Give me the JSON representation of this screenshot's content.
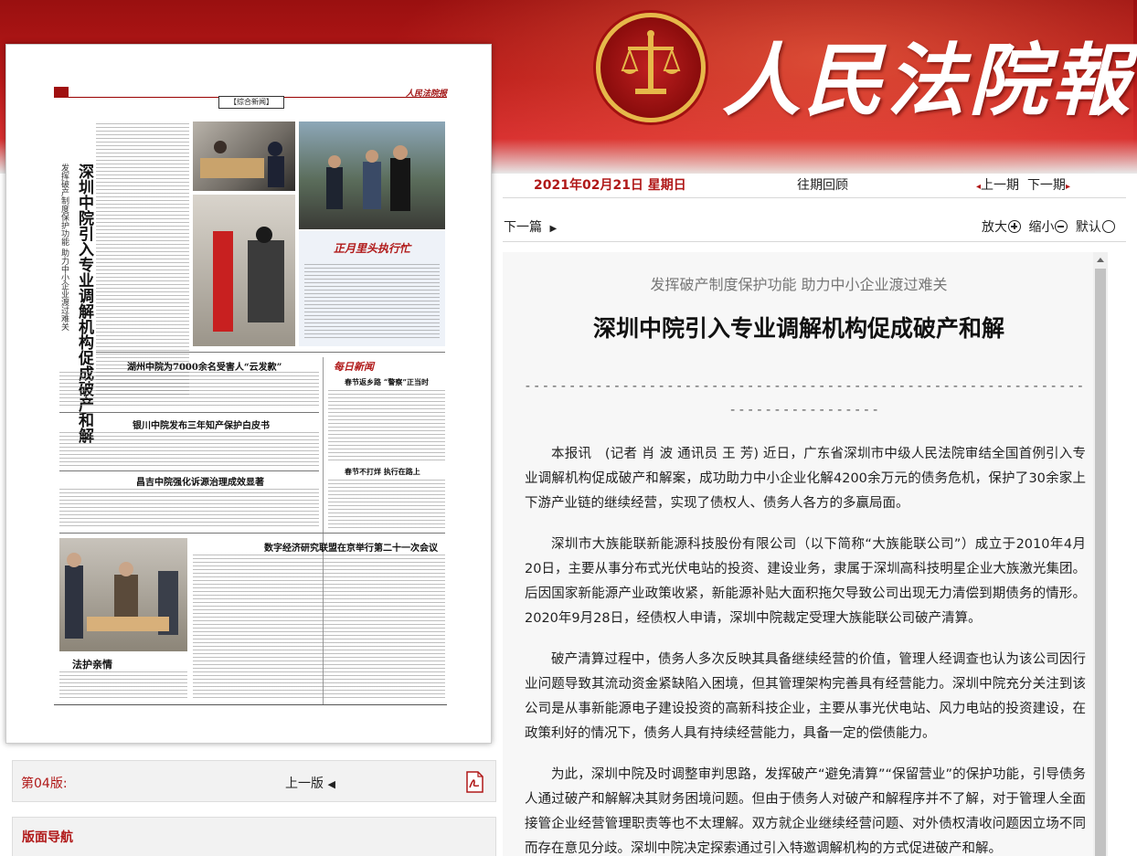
{
  "masthead": {
    "name": "人民法院報"
  },
  "page_thumbnail": {
    "section_label": "【综合新闻】",
    "paper_logo": "人民法院报",
    "main_title": "深圳中院引入专业调解机构促成破产和解",
    "main_subtitle": "发挥破产制度保护功能 助力中小企业渡过难关",
    "photo_caption_1": "正月里头执行忙",
    "headline_2": "湖州中院为7000余名受害人“云发款”",
    "headline_3": "银川中院发布三年知产保护白皮书",
    "headline_4": "昌吉中院强化诉源治理成效显著",
    "headline_5": "数字经济研究联盟在京举行第二十一次会议",
    "photo_caption_2": "法护亲情",
    "side_column_title": "每日新闻",
    "side_item_1": "春节返乡路 “警察”正当时",
    "side_item_2": "春节不打烊 执行在路上"
  },
  "edition": {
    "label": "第04版:",
    "prev": "上一版",
    "pdf_icon": "pdf-icon"
  },
  "nav": {
    "title": "版面导航"
  },
  "datebar": {
    "date": "2021年02月21日 星期日",
    "past": "往期回顾",
    "prev_issue": "上一期",
    "next_issue": "下一期"
  },
  "toolbar": {
    "next_article": "下一篇",
    "zoom_in": "放大",
    "zoom_out": "缩小",
    "default": "默认"
  },
  "article": {
    "subtitle": "发挥破产制度保护功能 助力中小企业渡过难关",
    "title": "深圳中院引入专业调解机构促成破产和解",
    "dashes": "--------------------------------------------------------------------------------",
    "paragraphs": [
      "本报讯　(记者 肖 波 通讯员 王 芳) 近日，广东省深圳市中级人民法院审结全国首例引入专业调解机构促成破产和解案，成功助力中小企业化解4200余万元的债务危机，保护了30余家上下游产业链的继续经营，实现了债权人、债务人各方的多赢局面。",
      "深圳市大族能联新能源科技股份有限公司（以下简称“大族能联公司”）成立于2010年4月20日，主要从事分布式光伏电站的投资、建设业务，隶属于深圳高科技明星企业大族激光集团。后因国家新能源产业政策收紧，新能源补贴大面积拖欠导致公司出现无力清偿到期债务的情形。2020年9月28日，经债权人申请，深圳中院裁定受理大族能联公司破产清算。",
      "破产清算过程中，债务人多次反映其具备继续经营的价值，管理人经调查也认为该公司因行业问题导致其流动资金紧缺陷入困境，但其管理架构完善具有经营能力。深圳中院充分关注到该公司是从事新能源电子建设投资的高新科技企业，主要从事光伏电站、风力电站的投资建设，在政策利好的情况下，债务人具有持续经营能力，具备一定的偿债能力。",
      "为此，深圳中院及时调整审判思路，发挥破产“避免清算”“保留营业”的保护功能，引导债务人通过破产和解解决其财务困境问题。但由于债务人对破产和解程序并不了解，对于管理人全面接管企业经营管理职责等也不太理解。双方就企业继续经营问题、对外债权清收问题因立场不同而存在意见分歧。深圳中院决定探索通过引入特邀调解机构的方式促进破产和解。"
    ]
  },
  "colors": {
    "brand_red": "#b01818",
    "banner_dark": "#9a1010",
    "emblem_gold": "#e6b84a"
  }
}
